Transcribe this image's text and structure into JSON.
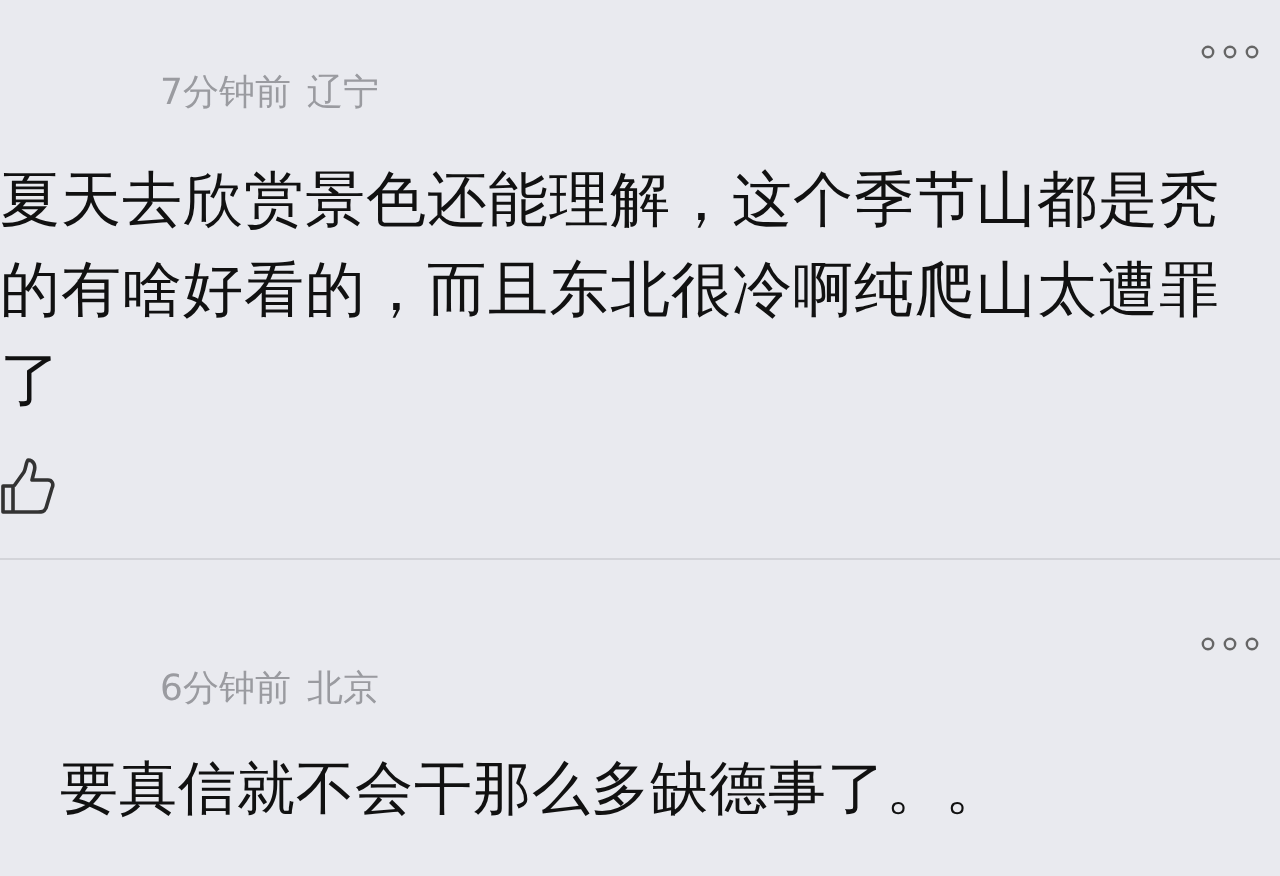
{
  "comments": [
    {
      "time": "7分钟前",
      "location": "辽宁",
      "text": "夏天去欣赏景色还能理解，这个季节山都是秃的有啥好看的，而且东北很冷啊纯爬山太遭罪了",
      "show_like": true
    },
    {
      "time": "6分钟前",
      "location": "北京",
      "text": "要真信就不会干那么多缺德事了。。",
      "show_like": false
    }
  ]
}
